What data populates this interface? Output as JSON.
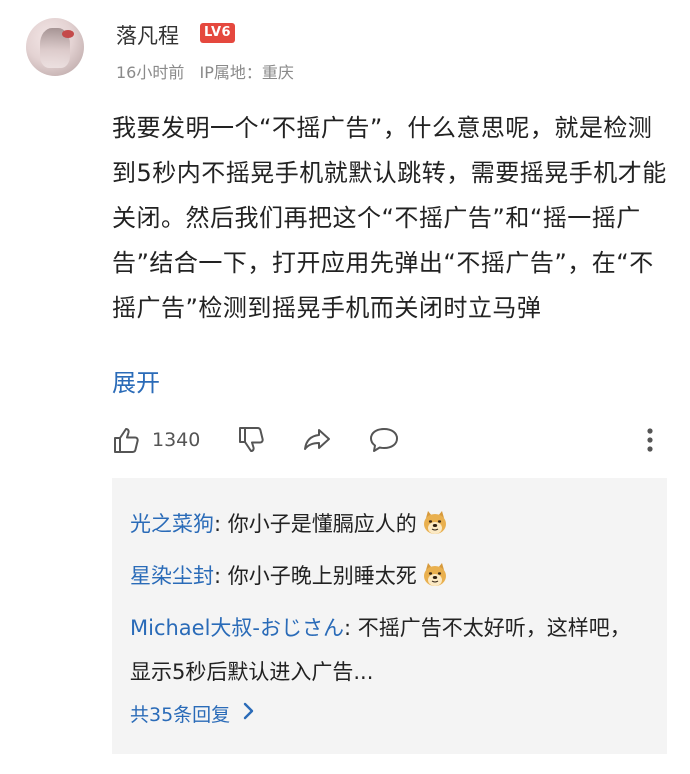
{
  "comment": {
    "username": "落凡程",
    "level_badge": "LV6",
    "time": "16小时前",
    "ip_location": "IP属地：重庆",
    "text": "我要发明一个“不摇广告”，什么意思呢，就是检测到5秒内不摇晃手机就默认跳转，需要摇晃手机才能关闭。然后我们再把这个“不摇广告”和“摇一摇广告”结合一下，打开应用先弹出“不摇广告”，在“不摇广告”检测到摇晃手机而关闭时立马弹",
    "expand_label": "展开",
    "like_count": "1340"
  },
  "icons": {
    "like": "thumbs-up-icon",
    "dislike": "thumbs-down-icon",
    "share": "share-icon",
    "reply": "comment-bubble-icon",
    "more": "more-vertical-icon",
    "emoji": "doge-emoji-icon"
  },
  "replies": [
    {
      "user": "光之菜狗",
      "separator": ": ",
      "text": "你小子是懂膈应人的"
    },
    {
      "user": "星染尘封",
      "separator": ": ",
      "text": "你小子晚上别睡太死"
    },
    {
      "user": "Michael大叔-おじさん",
      "separator": ": ",
      "text": "不摇广告不太好听，这样吧，显示5秒后默认进入广告..."
    }
  ],
  "all_replies_label": "共35条回复",
  "colors": {
    "link_blue": "#2a6bb8",
    "badge_red": "#e5483e",
    "reply_bg": "#f4f4f4",
    "meta_gray": "#8a8a8a"
  }
}
